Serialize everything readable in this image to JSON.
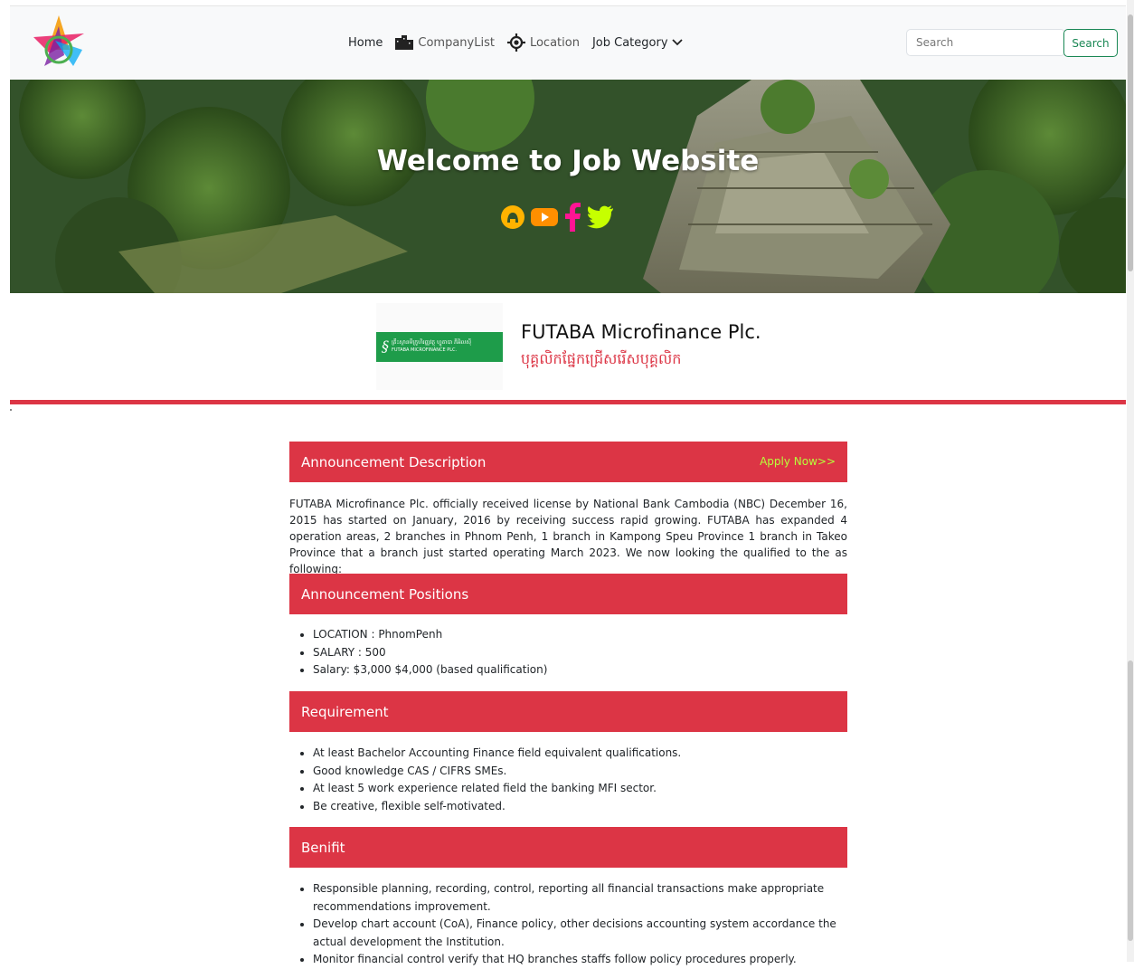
{
  "nav": {
    "home": "Home",
    "company_list": "CompanyList",
    "location": "Location",
    "job_category": "Job Category",
    "search_placeholder": "Search",
    "search_button": "Search"
  },
  "hero": {
    "title": "Welcome to Job Website",
    "social_icons": [
      "github-icon",
      "youtube-icon",
      "facebook-icon",
      "twitter-icon"
    ]
  },
  "company": {
    "name": "FUTABA Microfinance Plc.",
    "subtitle": "បុគ្គលិកផ្នែកជ្រើសរើសបុគ្គលិក",
    "logo_text_khmer": "គ្រឹះស្ថានមីក្រូហិរញ្ញវត្ថុ ហ្វូតាបា ភីអិលស៊ី",
    "logo_text_en": "FUTABA MICROFINANCE PLC."
  },
  "sections": {
    "description": {
      "title": "Announcement Description",
      "apply": "Apply Now>>",
      "text": "FUTABA Microfinance Plc. officially received license by National Bank Cambodia (NBC) December 16, 2015 has started on January, 2016 by receiving success rapid growing. FUTABA has expanded 4 operation areas, 2 branches in Phnom Penh, 1 branch in Kampong Speu Province 1 branch in Takeo Province that a branch just started operating March 2023. We now looking the qualified to the as following:"
    },
    "positions": {
      "title": "Announcement Positions",
      "items": [
        "LOCATION : PhnomPenh",
        "SALARY : 500",
        "Salary: $3,000 $4,000 (based qualification)"
      ]
    },
    "requirement": {
      "title": "Requirement",
      "items": [
        "At least Bachelor Accounting Finance field equivalent qualifications.",
        "Good knowledge CAS / CIFRS SMEs.",
        "At least 5 work experience related field the banking MFI sector.",
        "Be creative, flexible self-motivated."
      ]
    },
    "benefit": {
      "title": "Benifit",
      "items": [
        "Responsible planning, recording, control, reporting all financial transactions make appropriate recommendations improvement.",
        "Develop chart account (CoA), Finance policy, other decisions accounting system accordance the actual development the Institution.",
        "Monitor financial control verify that HQ branches staffs follow policy procedures properly."
      ]
    }
  },
  "colors": {
    "brand_red": "#dc3545",
    "apply_green": "#b7ff3b",
    "search_green": "#198754"
  }
}
